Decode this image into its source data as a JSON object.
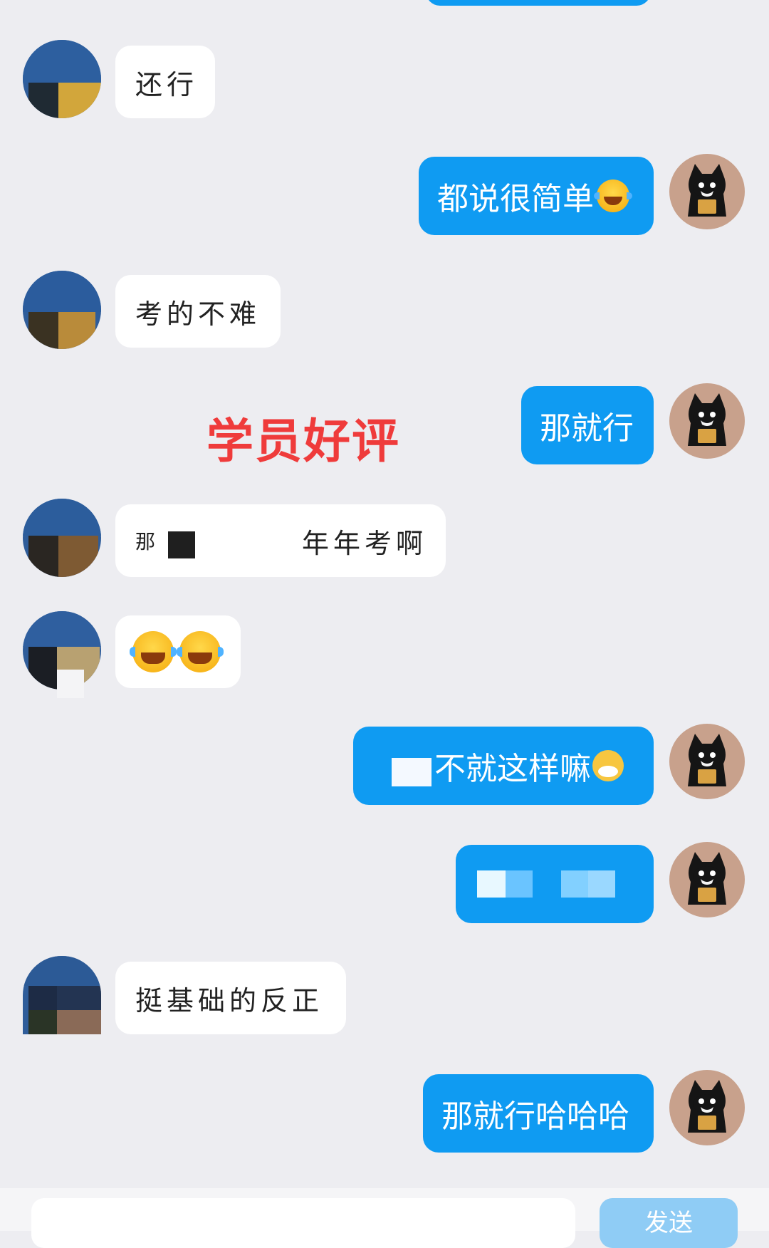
{
  "messages": [
    {
      "side": "in",
      "text": "还行"
    },
    {
      "side": "out",
      "text": "都说很简单",
      "emoji": "tears-of-joy-emoji"
    },
    {
      "side": "in",
      "text": "考的不难"
    },
    {
      "side": "out",
      "text": "那就行"
    },
    {
      "side": "in",
      "text_start": "那",
      "text_end": "年年考啊"
    },
    {
      "side": "in",
      "emoji": [
        "tears-of-joy-emoji",
        "tears-of-joy-emoji"
      ]
    },
    {
      "side": "out",
      "text": "不就这样嘛",
      "emoji": "cat-face-emoji"
    },
    {
      "side": "out",
      "text": ""
    },
    {
      "side": "in",
      "text": "挺基础的反正"
    },
    {
      "side": "out",
      "text": "那就行哈哈哈"
    }
  ],
  "overlay": {
    "caption": "学员好评",
    "color": "#ef3b3b"
  },
  "input_bar": {
    "send_label": "发送"
  },
  "colors": {
    "outgoing_bubble": "#0f9bf2",
    "incoming_bubble": "#ffffff",
    "background": "#ededf1"
  }
}
